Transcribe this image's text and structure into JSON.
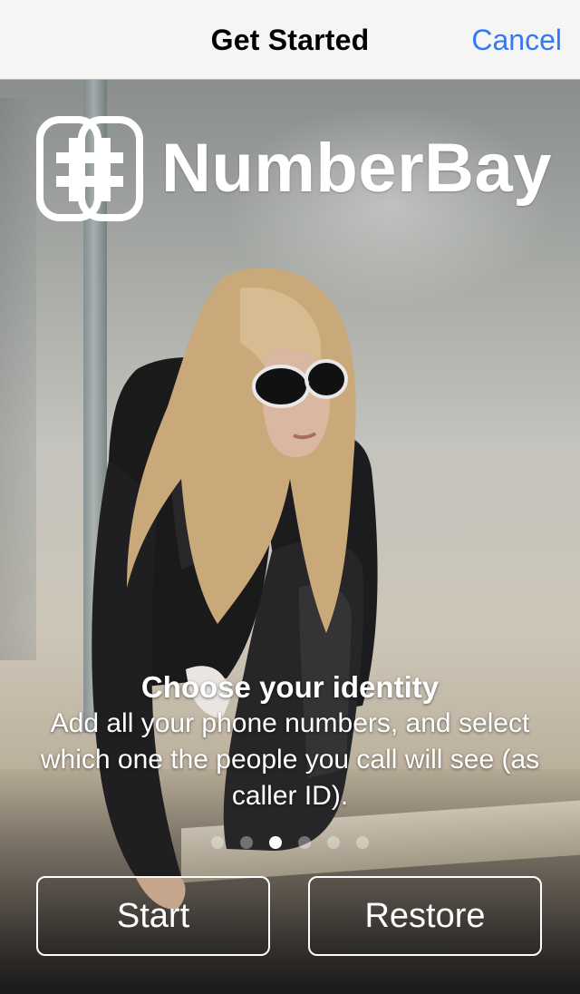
{
  "nav": {
    "title": "Get Started",
    "cancel_label": "Cancel"
  },
  "brand": {
    "name": "NumberBay",
    "icon": "numberbay-hash-logo-icon"
  },
  "onboarding": {
    "title": "Choose your identity",
    "body": "Add all your phone numbers, and select which one the people you call will see (as caller ID).",
    "pages": {
      "count": 6,
      "current": 3
    }
  },
  "actions": {
    "start_label": "Start",
    "restore_label": "Restore"
  },
  "colors": {
    "accent": "#3478f6",
    "navbar_bg": "#f5f5f4",
    "text_on_photo": "#ffffff"
  }
}
